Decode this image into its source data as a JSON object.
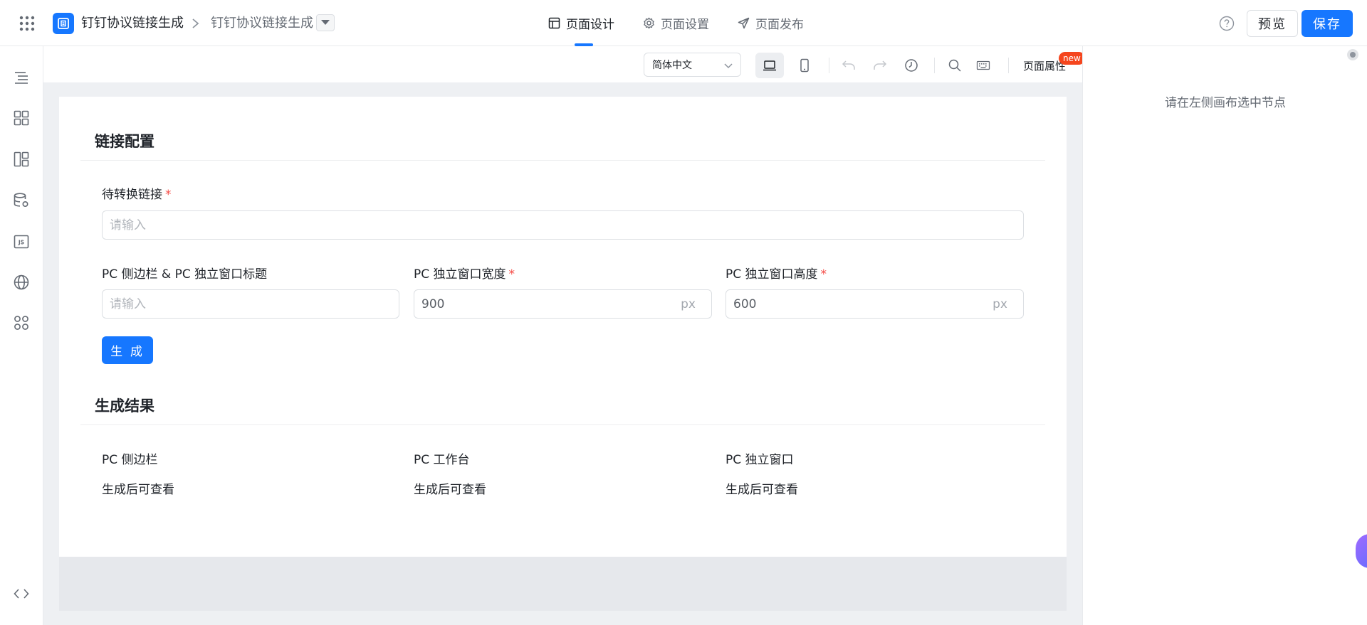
{
  "header": {
    "app_name": "钉钉协议链接生成",
    "page_name": "钉钉协议链接生成",
    "tabs": [
      {
        "label": "页面设计",
        "icon": "layout-icon",
        "active": true
      },
      {
        "label": "页面设置",
        "icon": "gear-icon",
        "active": false
      },
      {
        "label": "页面发布",
        "icon": "send-icon",
        "active": false
      }
    ],
    "preview_label": "预览",
    "save_label": "保存",
    "accent_color": "#1677ff"
  },
  "left_rail": {
    "items": [
      "outline-icon",
      "components-icon",
      "layout-blocks-icon",
      "datasource-icon",
      "js-icon",
      "globe-icon",
      "apps-icon",
      "code-toggle-icon"
    ]
  },
  "toolbar": {
    "language": "简体中文",
    "page_attr_label": "页面属性",
    "new_badge": "new",
    "buttons": [
      "desktop-icon",
      "mobile-icon",
      "undo-icon",
      "redo-icon",
      "history-icon",
      "search-icon",
      "keyboard-icon"
    ]
  },
  "form": {
    "section_title": "链接配置",
    "link_label": "待转换链接",
    "link_placeholder": "请输入",
    "title_label": "PC 侧边栏 & PC 独立窗口标题",
    "title_placeholder": "请输入",
    "width_label": "PC 独立窗口宽度",
    "width_value": "900",
    "width_unit": "px",
    "height_label": "PC 独立窗口高度",
    "height_value": "600",
    "height_unit": "px",
    "required_mark": "*",
    "generate_label": "生 成"
  },
  "result": {
    "section_title": "生成结果",
    "items": [
      {
        "label": "PC 侧边栏",
        "value": "生成后可查看"
      },
      {
        "label": "PC 工作台",
        "value": "生成后可查看"
      },
      {
        "label": "PC 独立窗口",
        "value": "生成后可查看"
      }
    ]
  },
  "right_panel": {
    "hint": "请在左侧画布选中节点"
  }
}
